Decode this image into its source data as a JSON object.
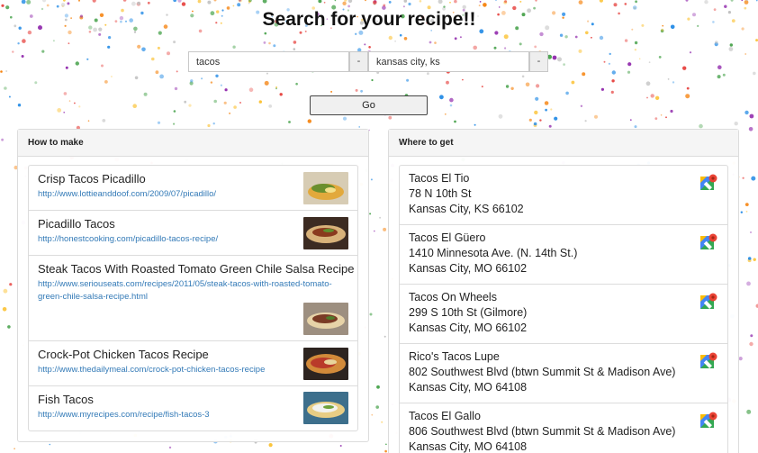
{
  "page": {
    "title": "Search for your recipe!!"
  },
  "search": {
    "query_value": "tacos",
    "query_addon": "-",
    "location_value": "kansas city, ks",
    "location_addon": "-",
    "go_label": "Go"
  },
  "how_to_make": {
    "heading": "How to make",
    "recipes": [
      {
        "title": "Crisp Tacos Picadillo",
        "url": "http://www.lottieanddoof.com/2009/07/picadillo/",
        "thumb": "taco-photo"
      },
      {
        "title": "Picadillo Tacos",
        "url": "http://honestcooking.com/picadillo-tacos-recipe/",
        "thumb": "taco-photo"
      },
      {
        "title": "Steak Tacos With Roasted Tomato Green Chile Salsa Recipe",
        "url": "http://www.seriouseats.com/recipes/2011/05/steak-tacos-with-roasted-tomato-green-chile-salsa-recipe.html",
        "thumb": "taco-photo"
      },
      {
        "title": "Crock-Pot Chicken Tacos Recipe",
        "url": "http://www.thedailymeal.com/crock-pot-chicken-tacos-recipe",
        "thumb": "taco-photo"
      },
      {
        "title": "Fish Tacos",
        "url": "http://www.myrecipes.com/recipe/fish-tacos-3",
        "thumb": "taco-photo"
      }
    ]
  },
  "where_to_get": {
    "heading": "Where to get",
    "places": [
      {
        "name": "Tacos El Tio",
        "street": "78 N 10th St",
        "city": "Kansas City, KS 66102",
        "icon": "google-maps-icon"
      },
      {
        "name": "Tacos El Güero",
        "street": "1410 Minnesota Ave. (N. 14th St.)",
        "city": "Kansas City, MO 66102",
        "icon": "google-maps-icon"
      },
      {
        "name": "Tacos On Wheels",
        "street": "299 S 10th St (Gilmore)",
        "city": "Kansas City, MO 66102",
        "icon": "google-maps-icon"
      },
      {
        "name": "Rico's Tacos Lupe",
        "street": "802 Southwest Blvd (btwn Summit St & Madison Ave)",
        "city": "Kansas City, MO 64108",
        "icon": "google-maps-icon"
      },
      {
        "name": "Tacos El Gallo",
        "street": "806 Southwest Blvd (btwn Summit St & Madison Ave)",
        "city": "Kansas City, MO 64108",
        "icon": "google-maps-icon"
      }
    ]
  },
  "colors": {
    "link": "#337ab7",
    "panel_heading_bg": "#f5f5f5",
    "border": "#dcdcdc",
    "confetti": [
      "#e53935",
      "#1e88e5",
      "#fbc02d",
      "#43a047",
      "#8e24aa",
      "#f57c00",
      "#bdbdbd"
    ]
  }
}
